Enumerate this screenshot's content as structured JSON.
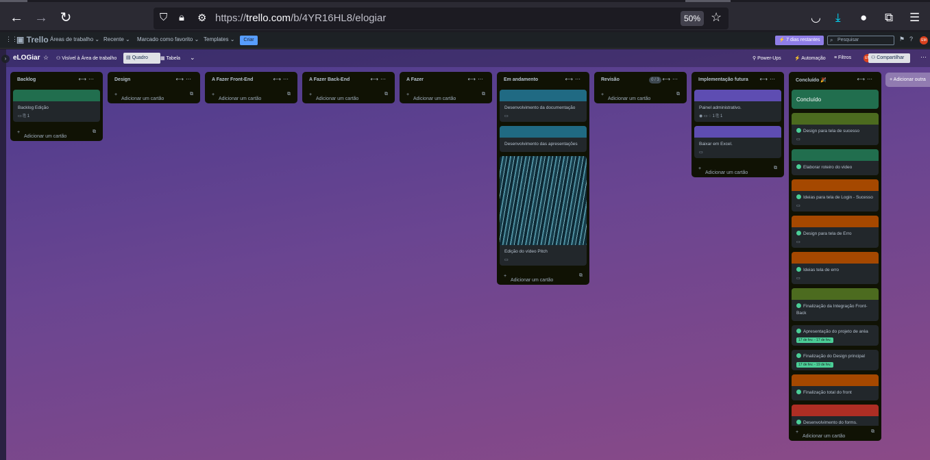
{
  "browser": {
    "url_prefix": "https://",
    "url_host": "trello.com",
    "url_path": "/b/4YR16HL8/elogiar",
    "zoom": "50%"
  },
  "topnav": {
    "logo": "Trello",
    "items": [
      "Áreas de trabalho",
      "Recente",
      "Marcado como favorito",
      "Templates"
    ],
    "create": "Criar",
    "trial": "7 dias restantes",
    "search_placeholder": "Pesquisar",
    "avatar": "EM"
  },
  "boardbar": {
    "title": "eLOGiar",
    "visibility": "Visível à Área de trabalho",
    "view_board": "Quadro",
    "view_table": "Tabela",
    "powerups": "Power-Ups",
    "automation": "Automação",
    "filters": "Filtros",
    "share": "Compartilhar",
    "avatar": "EM"
  },
  "add_card_label": "Adicionar um cartão",
  "add_list_label": "Adicionar outra",
  "lists": [
    {
      "name": "Backlog",
      "cards": [
        {
          "cover": "#216e4e",
          "title": "Backlog Edição",
          "meta": "▭  ⎘ 1"
        }
      ]
    },
    {
      "name": "Design",
      "cards": []
    },
    {
      "name": "A Fazer Front-End",
      "cards": []
    },
    {
      "name": "A Fazer Back-End",
      "cards": []
    },
    {
      "name": "A Fazer",
      "cards": []
    },
    {
      "name": "Em andamento",
      "cards": [
        {
          "cover": "#206a83",
          "title": "Desenvolvimento da documentação",
          "meta": "▭"
        },
        {
          "cover": "#206a83",
          "title": "Desenvolvimento das apresentações",
          "meta": ""
        },
        {
          "cover": "image",
          "title": "Edição do vídeo Pitch",
          "meta": "▭"
        }
      ]
    },
    {
      "name": "Revisão",
      "count": "0 / 3",
      "cards": []
    },
    {
      "name": "Implementação futura",
      "cards": [
        {
          "cover": "#5e4db2",
          "title": "Painel administrativo.",
          "meta": "◉  ▭  ◌ 1  ⎘ 1"
        },
        {
          "cover": "#5e4db2",
          "title": "Baixar em Excel.",
          "meta": "▭"
        }
      ]
    },
    {
      "name": "Concluído 🎉",
      "cards": [
        {
          "cover": "#216e4e",
          "title": "Concluído",
          "meta": "",
          "big": true
        },
        {
          "cover": "#4c6b1f",
          "title": "Design para tela de sucesso",
          "meta": "▭",
          "done": true
        },
        {
          "cover": "#216e4e",
          "title": "Elaborar roteiro do video",
          "meta": "",
          "done": true
        },
        {
          "cover": "#a54800",
          "title": "Ideias para tela de Login - Sucesso",
          "meta": "▭",
          "done": true
        },
        {
          "cover": "#a54800",
          "title": "Design para tela de Erro",
          "meta": "▭",
          "done": true
        },
        {
          "cover": "#a54800",
          "title": "Ideias tela de erro",
          "meta": "▭",
          "done": true
        },
        {
          "cover": "#4c6b1f",
          "title": "Finalização da Integração Front-Back",
          "meta": "",
          "done": true
        },
        {
          "cover": "",
          "title": "Apresentação do projeto de aréa",
          "date": "17 de fev. - 17 de fev.",
          "done": true
        },
        {
          "cover": "",
          "title": "Finalização do Design principal",
          "date": "17 de fev. - 19 de fev.",
          "done": true
        },
        {
          "cover": "#a54800",
          "title": "Finalização total do front",
          "meta": "",
          "done": true
        },
        {
          "cover": "#ae2e24",
          "title": "Desenvolvimento do forms.",
          "meta": "▭  ⎘ 1",
          "done": true
        }
      ]
    }
  ]
}
